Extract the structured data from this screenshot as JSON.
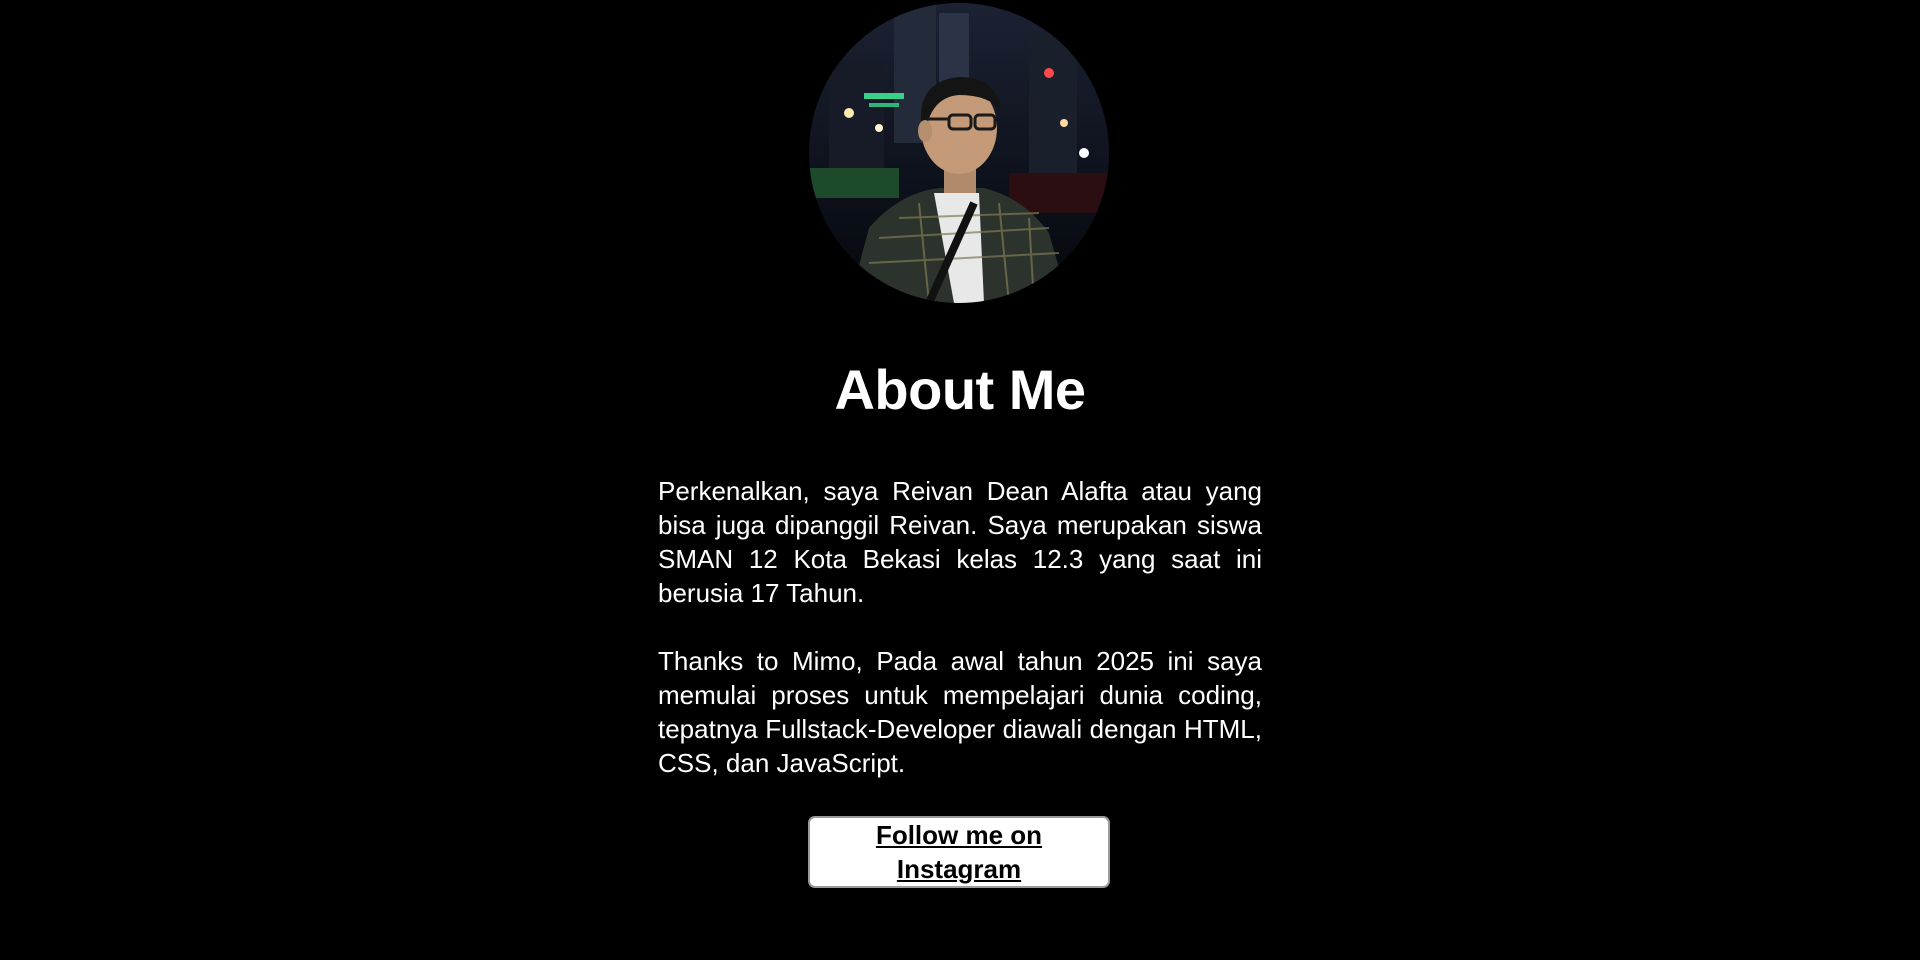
{
  "profile": {
    "avatar_icon": "profile-photo"
  },
  "about": {
    "title": "About Me",
    "paragraph_1": "Perkenalkan, saya Reivan Dean Alafta atau yang bisa juga dipanggil Reivan. Saya merupakan siswa SMAN 12 Kota Bekasi kelas 12.3 yang saat ini berusia 17 Tahun.",
    "paragraph_2": "Thanks to Mimo, Pada awal tahun 2025 ini saya memulai proses untuk mempelajari dunia coding, tepatnya Fullstack-Developer diawali dengan HTML, CSS, dan JavaScript."
  },
  "cta": {
    "instagram_label": "Follow me on Instagram"
  },
  "colors": {
    "background": "#000000",
    "text": "#ffffff",
    "button_bg": "#ffffff",
    "button_text": "#000000"
  }
}
